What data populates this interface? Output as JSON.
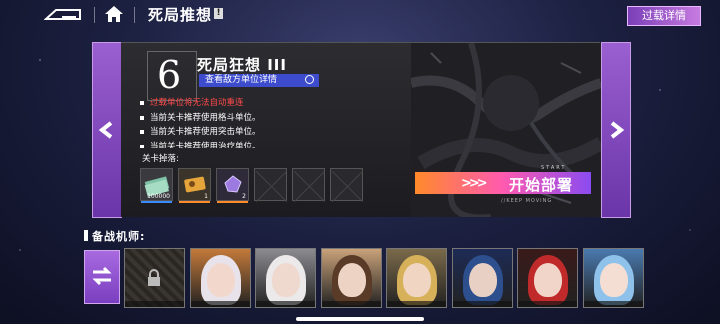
{
  "header": {
    "title": "死局推想",
    "info_badge": "!",
    "overload_button": "过载详情"
  },
  "stage": {
    "number": "6",
    "name": "死局狂想 III",
    "enemy_details_button": "查看敌方单位详情",
    "notes": [
      "过载单位将无法自动重连",
      "当前关卡推荐使用格斗单位。",
      "当前关卡推荐使用突击单位。",
      "当前关卡推荐使用治疗单位。"
    ],
    "drops_label": "关卡掉落:",
    "drops": [
      {
        "icon": "cash-bundle-icon",
        "count": "100000",
        "bar_color": "#3a8bff"
      },
      {
        "icon": "ticket-icon",
        "count": "1",
        "bar_color": "#ff8a2a"
      },
      {
        "icon": "purple-crystal-icon",
        "count": "2",
        "bar_color": "#ff8a2a"
      },
      {
        "icon": "empty-slot",
        "count": ""
      },
      {
        "icon": "empty-slot",
        "count": ""
      },
      {
        "icon": "empty-slot",
        "count": ""
      }
    ],
    "start_button": "开始部署",
    "start_small": "START",
    "keep_moving": "//KEEP MOVING"
  },
  "roster": {
    "label": "备战机师:",
    "cards": [
      {
        "name": "locked-card",
        "locked": true
      },
      {
        "name": "pilot-white-hair",
        "hair": "#e8e3ea",
        "skin": "#f2d8cc",
        "bg": "#c47a3a"
      },
      {
        "name": "pilot-blindfold",
        "hair": "#ece9ea",
        "skin": "#efd9cf",
        "bg": "#8b8b90"
      },
      {
        "name": "pilot-brown-hair",
        "hair": "#5a3b28",
        "skin": "#edd3c3",
        "bg": "#c9a27a"
      },
      {
        "name": "pilot-blonde-helmet",
        "hair": "#d7b15a",
        "skin": "#f0d6c2",
        "bg": "#7a6a4a"
      },
      {
        "name": "pilot-blue-hair",
        "hair": "#2e4f8e",
        "skin": "#e9d0c4",
        "bg": "#1d2b55"
      },
      {
        "name": "pilot-red-hair",
        "hair": "#c02a2a",
        "skin": "#f1d5c9",
        "bg": "#3a1a1a"
      },
      {
        "name": "pilot-light-blue",
        "hair": "#8fc2ea",
        "skin": "#f4ded3",
        "bg": "#4a7ab0"
      }
    ]
  },
  "colors": {
    "accent_purple": "#8a4bd0",
    "start_gradient": "#ff8a2a"
  }
}
